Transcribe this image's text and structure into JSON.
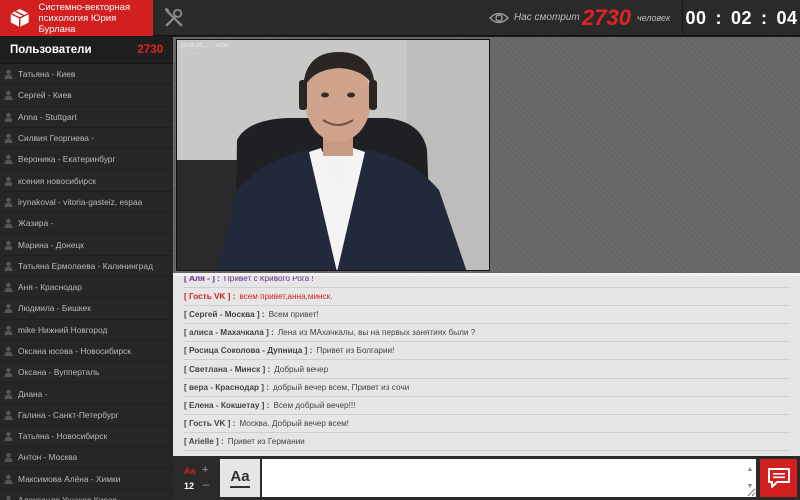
{
  "header": {
    "brand_line1": "Системно-векторная",
    "brand_line2": "психология Юрия Бурлана",
    "watch_label": "Нас смотрит",
    "watch_count": "2730",
    "watch_unit": "человек",
    "timer": {
      "hours": "00",
      "minutes": "02",
      "seconds": "04"
    }
  },
  "sidebar": {
    "title": "Пользователи",
    "count": "2730",
    "users": [
      "Татьяна - Киев",
      "Сергей - Киев",
      "Anna - Stuttgart",
      "Силвия Георгиева -",
      "Вероника - Екатеринбург",
      "ксения новосибирск",
      "irynakoval - vitoria-gasteiz, espaa",
      "Жазира -",
      "Марина - Донецк",
      "Татьяна Ермолаева - Калининград",
      "Аня - Краснодар",
      "Людмила - Бишкек",
      "mike Нижний Новгород",
      "Оксана юсова - Новосибирск",
      "Оксана - Вупперталь",
      "Диана -",
      "Галина - Санкт-Петербург",
      "Татьяна - Новосибирск",
      "Антон - Москва",
      "Максимова Алёна - Химки",
      "Александр Ушаков Киров"
    ]
  },
  "video": {
    "overlay_line1": "12:05:25 ...  ... MOV",
    "overlay_line2": "... .. ...."
  },
  "chat": {
    "messages": [
      {
        "nick": "[ Аля - ] :",
        "text": "Привет с Кривого Рога !",
        "color": "purple"
      },
      {
        "nick": "[ Гость VK ] :",
        "text": "всем привет,анна,минск.",
        "color": "red"
      },
      {
        "nick": "[ Сергей - Москва ] :",
        "text": "Всем привет!",
        "color": "default"
      },
      {
        "nick": "[ алиса - Махачкала ] :",
        "text": "Лена из МАхачкалы, вы на первых занятиях были ?",
        "color": "default"
      },
      {
        "nick": "[ Росица Соколова - Дупница ] :",
        "text": "Привет из Болгарии!",
        "color": "default"
      },
      {
        "nick": "[ Светлана - Минск ] :",
        "text": "Добрый вечер",
        "color": "default"
      },
      {
        "nick": "[ вера - Краснодар ] :",
        "text": "добрый вечер всем, Привет из сочи",
        "color": "default"
      },
      {
        "nick": "[ Елена - Кокшетау ] :",
        "text": "Всем добрый вечер!!!",
        "color": "default"
      },
      {
        "nick": "[ Гость VK ] :",
        "text": "Москва. Добрый вечер всем!",
        "color": "default"
      },
      {
        "nick": "[ Arielle ] :",
        "text": "Привет из Германии",
        "color": "default"
      }
    ]
  },
  "composer": {
    "font_label": "Aa",
    "font_size": "12",
    "plus": "+",
    "minus": "–",
    "format_label": "Aa",
    "input_value": "",
    "arrow_up": "▲",
    "arrow_down": "▼"
  },
  "colors": {
    "accent": "#d21f1f",
    "topbar": "#2a2a2a",
    "sidebar": "#262626",
    "chat_bg": "#e6e6e6"
  },
  "icons": [
    "logo-box-icon",
    "tools-icon",
    "eye-icon",
    "user-icon",
    "send-chat-icon"
  ]
}
